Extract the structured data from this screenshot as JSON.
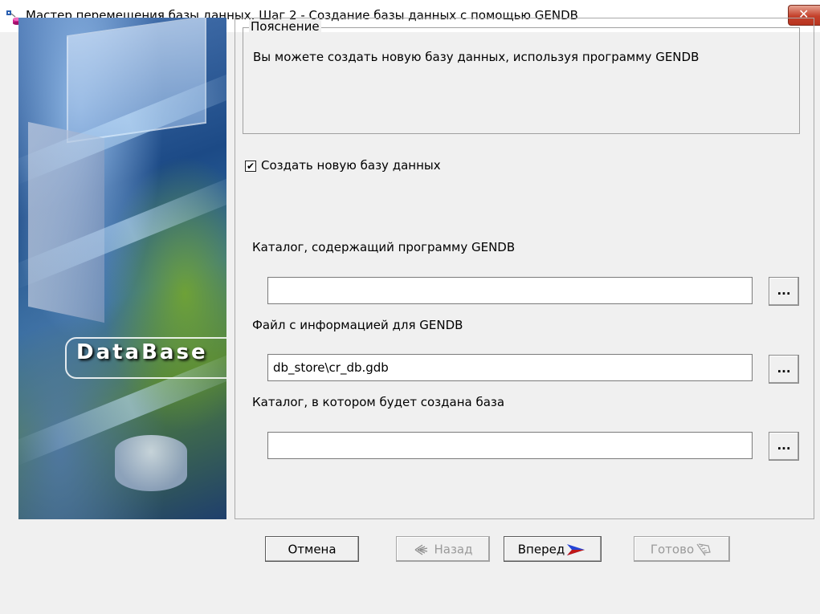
{
  "window": {
    "title": "Мастер перемещения базы данных. Шаг 2 - Создание базы данных с помощью GENDB",
    "close_icon": "close-icon"
  },
  "banner": {
    "text": "DataBase"
  },
  "explanation": {
    "legend": "Пояснение",
    "text": "Вы можете создать новую базу данных, используя программу GENDB"
  },
  "create_db": {
    "label": "Создать новую базу данных",
    "checked": true
  },
  "fields": [
    {
      "label": "Каталог, содержащий программу GENDB",
      "value": "",
      "browse": "..."
    },
    {
      "label": "Файл с информацией для GENDB",
      "value": "db_store\\cr_db.gdb",
      "browse": "..."
    },
    {
      "label": "Каталог, в котором будет создана база",
      "value": "",
      "browse": "..."
    }
  ],
  "buttons": {
    "cancel": "Отмена",
    "back": "Назад",
    "next": "Вперед",
    "finish": "Готово"
  }
}
